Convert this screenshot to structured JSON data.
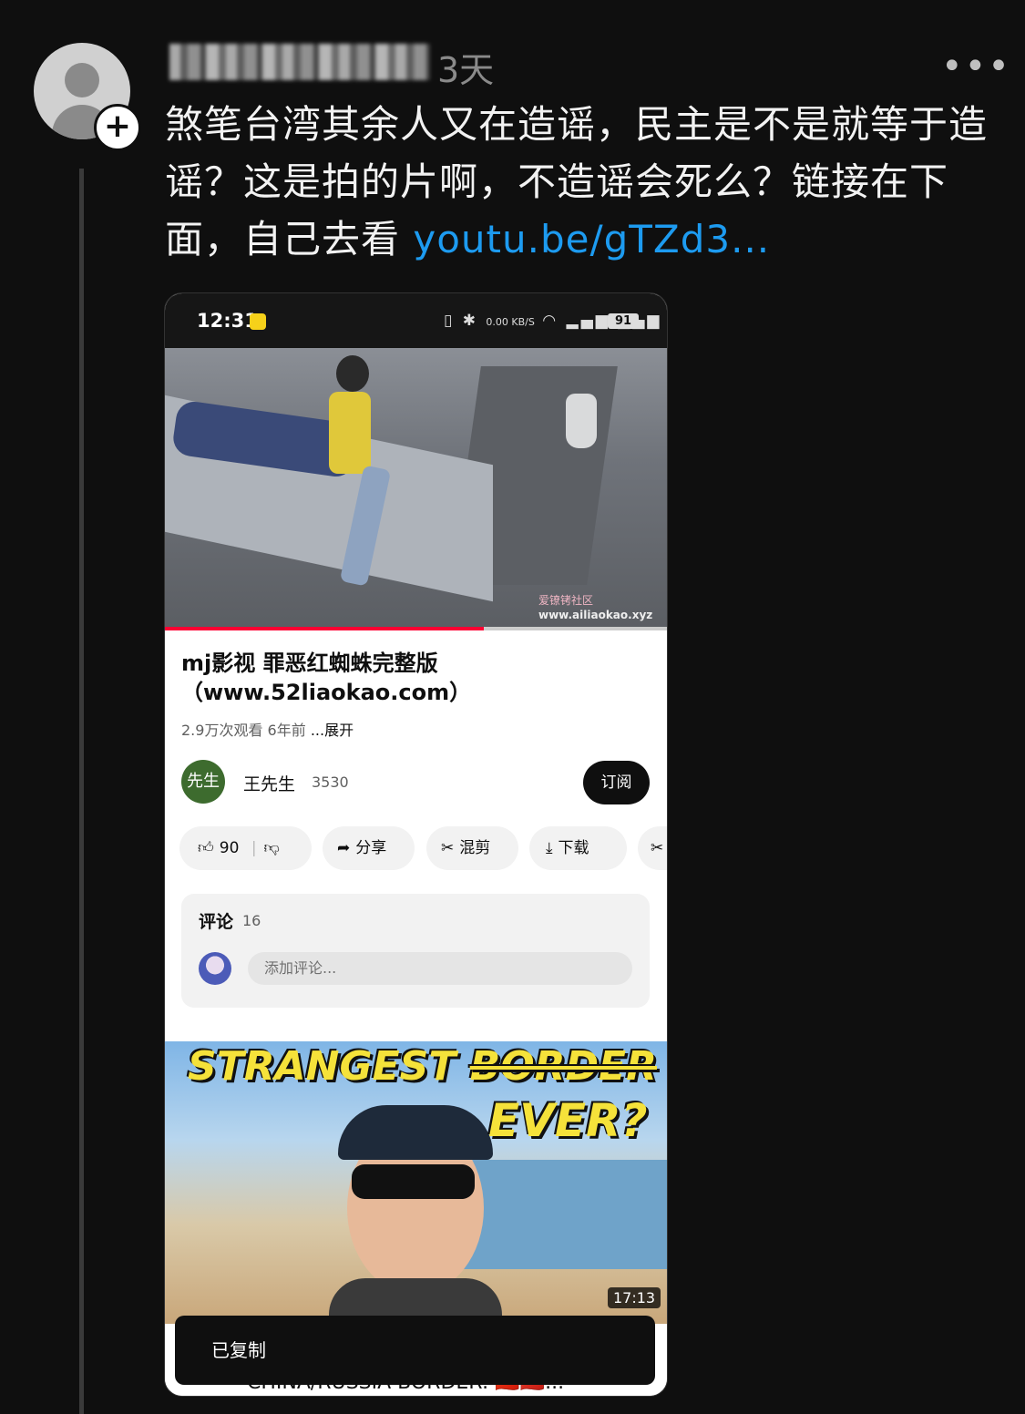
{
  "post": {
    "time": "3天",
    "more_icon": "more-horizontal-icon",
    "text": "煞笔台湾其余人又在造谣，民主是不是就等于造谣？这是拍的片啊，不造谣会死么？链接在下面，自己去看 ",
    "link": "youtu.be/gTZd3..."
  },
  "screenshot": {
    "status": {
      "time": "12:31",
      "network_speed": "0.00 KB/S",
      "battery": "91"
    },
    "video": {
      "watermark_line1": "爱镣铐社区",
      "watermark_line2": "www.ailiaokao.xyz"
    },
    "title": "mj影视 罪恶红蜘蛛完整版（www.52liaokao.com）",
    "views": "2.9万次观看",
    "age": "6年前",
    "expand": "...展开",
    "channel": {
      "avatar_text": "先生",
      "name": "王先生",
      "subs": "3530",
      "subscribe": "订阅"
    },
    "actions": {
      "likes": "90",
      "share": "分享",
      "remix": "混剪",
      "download": "下载"
    },
    "comments": {
      "label": "评论",
      "count": "16",
      "placeholder": "添加评论..."
    },
    "next_video": {
      "title_line1": "STRANGEST",
      "title_strike": "BORDER",
      "title_line2": "EVER?",
      "duration": "17:13",
      "caption": "CHINA/RUSSIA BORDER: 🇨🇳🇷🇺..."
    },
    "toast": "已复制"
  },
  "colors": {
    "background": "#0f0f0f",
    "link": "#1d9bf0",
    "progress": "#ff0033"
  }
}
